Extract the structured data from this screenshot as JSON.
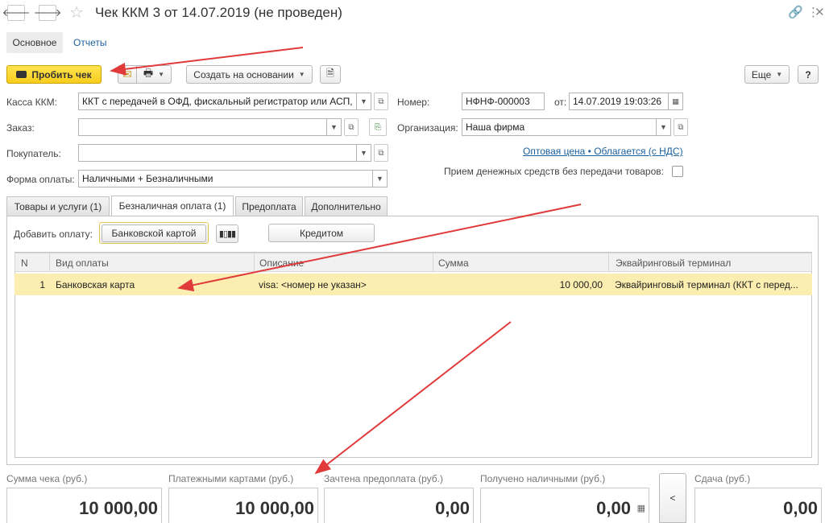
{
  "window": {
    "title": "Чек ККМ 3 от 14.07.2019 (не проведен)",
    "back_glyph": "🡐",
    "forward_glyph": "🡒",
    "star_glyph": "☆",
    "link_glyph": "🔗",
    "more_glyph": "⋮",
    "close_glyph": "✕"
  },
  "sections": {
    "main": "Основное",
    "reports": "Отчеты"
  },
  "toolbar": {
    "print_check": "Пробить чек",
    "create_based": "Создать на основании",
    "more": "Еще",
    "help": "?",
    "mail_glyph": "✉",
    "printer_glyph": "🖶",
    "doc_glyph": "🗎"
  },
  "form": {
    "kkm_label": "Касса ККМ:",
    "kkm_value": "ККТ с передачей в ОФД, фискальный регистратор или АСП,",
    "number_label": "Номер:",
    "number_value": "НФНФ-000003",
    "date_label": "от:",
    "date_value": "14.07.2019 19:03:26",
    "order_label": "Заказ:",
    "order_value": "",
    "org_label": "Организация:",
    "org_value": "Наша фирма",
    "buyer_label": "Покупатель:",
    "buyer_value": "",
    "price_link": "Оптовая цена • Облагается (с НДС)",
    "payment_label": "Форма оплаты:",
    "payment_value": "Наличными + Безналичными",
    "no_goods_label": "Прием денежных средств без передачи товаров:"
  },
  "tabs": [
    {
      "label": "Товары и услуги (1)"
    },
    {
      "label": "Безналичная оплата (1)"
    },
    {
      "label": "Предоплата"
    },
    {
      "label": "Дополнительно"
    }
  ],
  "payment_panel": {
    "add_label": "Добавить оплату:",
    "bank_card_button": "Банковской картой",
    "credit_button": "Кредитом"
  },
  "table": {
    "headers": [
      "N",
      "Вид оплаты",
      "Описание",
      "Сумма",
      "Эквайринговый терминал"
    ],
    "rows": [
      {
        "n": "1",
        "type": "Банковская карта",
        "desc": "visa: <номер не указан>",
        "sum": "10 000,00",
        "terminal": "Эквайринговый терминал  (ККТ с перед..."
      }
    ]
  },
  "totals": {
    "check_sum_label": "Сумма чека (руб.)",
    "check_sum_value": "10 000,00",
    "cards_label": "Платежными картами (руб.)",
    "cards_value": "10 000,00",
    "prepaid_label": "Зачтена предоплата (руб.)",
    "prepaid_value": "0,00",
    "cash_label": "Получено наличными (руб.)",
    "cash_value": "0,00",
    "toggle": "<",
    "change_label": "Сдача (руб.)",
    "change_value": "0,00"
  },
  "colors": {
    "accent_yellow": "#f7cd1d",
    "row_highlight": "#fbeeb0",
    "link": "#1a5f9c",
    "arrow": "#e03a3a"
  }
}
